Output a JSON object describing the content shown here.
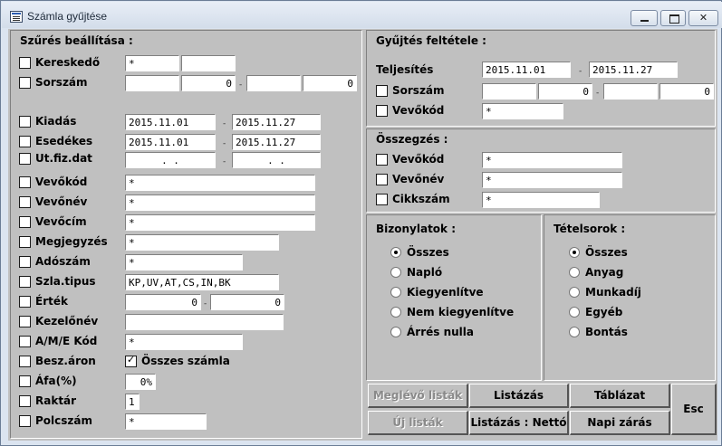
{
  "window": {
    "title": "Számla gyűjtése"
  },
  "filter": {
    "title": "Szűrés beállítása :",
    "kereskedo": {
      "label": "Kereskedő",
      "v1": "*",
      "v2": ""
    },
    "sorszam": {
      "label": "Sorszám",
      "v1": "",
      "v2": "0",
      "v3": "",
      "v4": "0"
    },
    "kiadas": {
      "label": "Kiadás",
      "from": "2015.11.01",
      "to": "2015.11.27"
    },
    "esedekes": {
      "label": "Esedékes",
      "from": "2015.11.01",
      "to": "2015.11.27"
    },
    "utfiz": {
      "label": "Ut.fiz.dat",
      "from": "  .  .  ",
      "to": "  .  .  "
    },
    "vevokod": {
      "label": "Vevőkód",
      "value": "*"
    },
    "vevonev": {
      "label": "Vevőnév",
      "value": "*"
    },
    "vevocim": {
      "label": "Vevőcím",
      "value": "*"
    },
    "megjegyzes": {
      "label": "Megjegyzés",
      "value": "*"
    },
    "adoszam": {
      "label": "Adószám",
      "value": "*"
    },
    "szlatipus": {
      "label": "Szla.tipus",
      "value": "KP,UV,AT,CS,IN,BK"
    },
    "ertek": {
      "label": "Érték",
      "from": "0",
      "to": "0"
    },
    "kezelonev": {
      "label": "Kezelőnév",
      "value": ""
    },
    "amekod": {
      "label": "A/M/E Kód",
      "value": "*"
    },
    "beszaron": {
      "label": "Besz.áron",
      "osszes_label": "Összes számla",
      "osszes_checked": true
    },
    "afa": {
      "label": "Áfa(%)",
      "value": "0%"
    },
    "raktar": {
      "label": "Raktár",
      "value": "1"
    },
    "polcszam": {
      "label": "Polcszám",
      "value": "*"
    }
  },
  "gyujtes": {
    "title": "Gyűjtés feltétele :",
    "teljesites": {
      "label": "Teljesítés",
      "from": "2015.11.01",
      "to": "2015.11.27"
    },
    "sorszam": {
      "label": "Sorszám",
      "v1": "",
      "v2": "0",
      "v3": "",
      "v4": "0"
    },
    "vevokod": {
      "label": "Vevőkód",
      "value": "*"
    }
  },
  "osszegzes": {
    "title": "Összegzés :",
    "vevokod": {
      "label": "Vevőkód",
      "value": "*"
    },
    "vevonev": {
      "label": "Vevőnév",
      "value": "*"
    },
    "cikkszam": {
      "label": "Cikkszám",
      "value": "*"
    }
  },
  "bizonylatok": {
    "title": "Bizonylatok :",
    "options": [
      "Összes",
      "Napló",
      "Kiegyenlítve",
      "Nem kiegyenlítve",
      "Árrés nulla"
    ],
    "selected": 0
  },
  "tetelsorok": {
    "title": "Tételsorok :",
    "options": [
      "Összes",
      "Anyag",
      "Munkadíj",
      "Egyéb",
      "Bontás"
    ],
    "selected": 0
  },
  "buttons": {
    "meglevo": "Meglévő listák",
    "uj": "Új listák",
    "listazas": "Listázás",
    "listazas_netto": "Listázás : Nettó",
    "tablazat": "Táblázat",
    "napi_zaras": "Napi zárás",
    "esc": "Esc"
  }
}
